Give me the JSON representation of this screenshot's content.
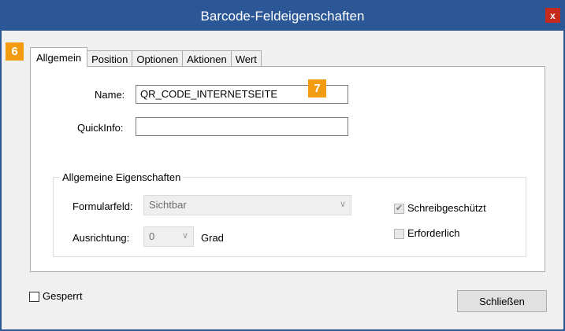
{
  "window": {
    "title": "Barcode-Feldeigenschaften",
    "close_glyph": "x"
  },
  "markers": {
    "tabs_marker": "6",
    "name_marker": "7",
    "color": "#f39c12"
  },
  "tabs": [
    {
      "label": "Allgemein",
      "active": true
    },
    {
      "label": "Position",
      "active": false
    },
    {
      "label": "Optionen",
      "active": false
    },
    {
      "label": "Aktionen",
      "active": false
    },
    {
      "label": "Wert",
      "active": false
    }
  ],
  "general": {
    "name_label": "Name:",
    "name_value": "QR_CODE_INTERNETSEITE",
    "tooltip_label": "QuickInfo:",
    "tooltip_value": ""
  },
  "properties": {
    "group_title": "Allgemeine Eigenschaften",
    "form_field_label": "Formularfeld:",
    "form_field_value": "Sichtbar",
    "orientation_label": "Ausrichtung:",
    "orientation_value": "0",
    "orientation_unit": "Grad",
    "readonly_label": "Schreibgeschützt",
    "readonly_checked": true,
    "required_label": "Erforderlich",
    "required_checked": false
  },
  "footer": {
    "locked_label": "Gesperrt",
    "locked_checked": false,
    "close_button": "Schließen"
  },
  "colors": {
    "titlebar": "#2b5797",
    "close": "#c42b1c"
  }
}
